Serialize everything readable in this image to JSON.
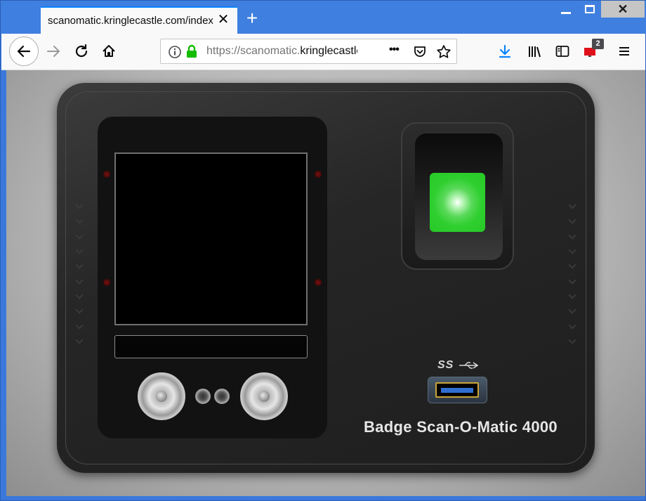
{
  "browser": {
    "tab_title": "scanomatic.kringlecastle.com/index",
    "tab_close_glyph": "✕",
    "new_tab_glyph": "+",
    "url_prefix": "https://scanomatic.",
    "url_host": "kringlecastle.com/index.html",
    "page_actions_glyph": "•••",
    "notification_count": "2",
    "window_close_glyph": "✕",
    "icons": [
      "back-icon",
      "forward-icon",
      "reload-icon",
      "home-icon",
      "info-icon",
      "lock-icon",
      "pocket-icon",
      "bookmark-star-icon",
      "download-icon",
      "library-icon",
      "sidebar-icon",
      "notification-icon",
      "menu-icon"
    ]
  },
  "device": {
    "label": "Badge Scan-O-Matic 4000",
    "usb_logo_text": "SS",
    "sensor_color": "#2ecf2e"
  }
}
